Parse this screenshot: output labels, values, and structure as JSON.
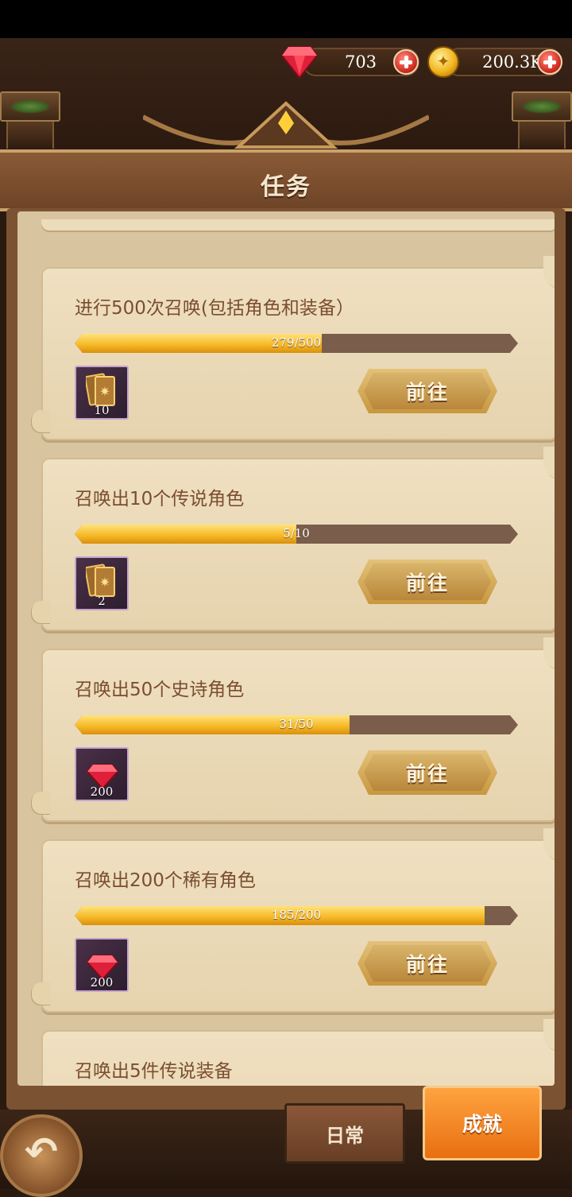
{
  "currency": {
    "gems": "703",
    "coins": "200.3K"
  },
  "header": {
    "title": "任务"
  },
  "tasks": [
    {
      "title": "进行500次召唤(包括角色和装备）",
      "progress_text": "279/500",
      "progress": 0.558,
      "reward_icon": "summon-card-icon",
      "reward_count": "10",
      "button": "前往"
    },
    {
      "title": "召唤出10个传说角色",
      "progress_text": "5/10",
      "progress": 0.5,
      "reward_icon": "summon-card-icon",
      "reward_count": "2",
      "button": "前往"
    },
    {
      "title": "召唤出50个史诗角色",
      "progress_text": "31/50",
      "progress": 0.62,
      "reward_icon": "gem-icon",
      "reward_count": "200",
      "button": "前往"
    },
    {
      "title": "召唤出200个稀有角色",
      "progress_text": "185/200",
      "progress": 0.925,
      "reward_icon": "gem-icon",
      "reward_count": "200",
      "button": "前往"
    },
    {
      "title": "召唤出5件传说装备"
    }
  ],
  "tabs": {
    "daily": "日常",
    "achievements": "成就"
  },
  "colors": {
    "accent_orange": "#f28a22",
    "progress_gold": "#f5b724",
    "parchment": "#e6d3ae"
  }
}
